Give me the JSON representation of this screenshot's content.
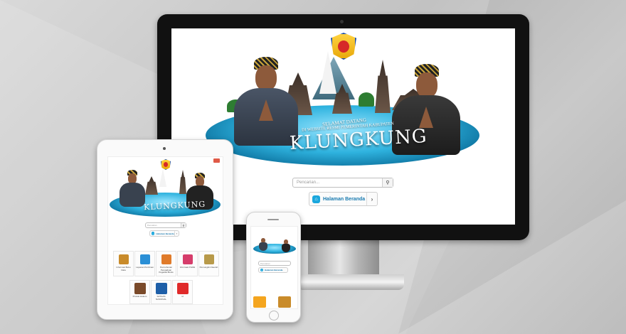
{
  "desktop": {
    "welcome_line1": "SELAMAT DATANG",
    "welcome_line2": "DI WEBSITE RESMI PEMERINTAH KABUPATEN",
    "title": "KLUNGKUNG",
    "search_placeholder": "Pencarian...",
    "search_icon": "search-icon",
    "home_button_label": "Halaman Beranda",
    "home_icon": "home-icon",
    "chevron_icon": "chevron-right-icon"
  },
  "tablet": {
    "title": "KLUNGKUNG",
    "search_placeholder": "Pencarian",
    "home_button_label": "Halaman Beranda",
    "tiles": [
      {
        "label": "Informasi Buku Data",
        "color": "#c98b2a"
      },
      {
        "label": "Layanan Perizinan",
        "color": "#2a8fd6"
      },
      {
        "label": "Permohonan Pengaduan Pegawai Bisnis",
        "color": "#e07b2a"
      },
      {
        "label": "Informasi Publik",
        "color": "#d63d6b"
      },
      {
        "label": "Pemungkin Daerah",
        "color": "#b89a4a"
      }
    ],
    "tiles2": [
      {
        "label": "Produk Hukum",
        "color": "#7a4a2a"
      },
      {
        "label": "SATGAS NASIONAL",
        "color": "#1e5fa8"
      },
      {
        "label": "id",
        "color": "#e02a2a"
      }
    ]
  },
  "phone": {
    "search_placeholder": "Pencarian",
    "home_button_label": "Halaman Beranda"
  }
}
